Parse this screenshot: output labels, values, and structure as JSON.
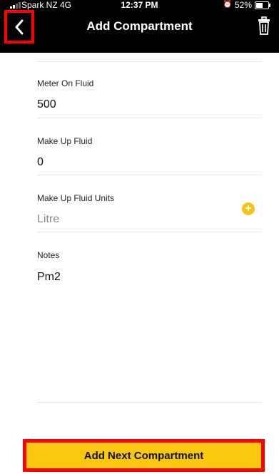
{
  "status_bar": {
    "carrier": "Spark NZ  4G",
    "time": "12:37 PM",
    "battery": "52%",
    "battery_level": 0.52
  },
  "nav": {
    "title": "Add Compartment"
  },
  "fields": {
    "meter_on_fluid": {
      "label": "Meter On Fluid",
      "value": "500"
    },
    "make_up_fluid": {
      "label": "Make Up Fluid",
      "value": "0"
    },
    "make_up_fluid_units": {
      "label": "Make Up Fluid Units",
      "placeholder": "Litre"
    },
    "notes": {
      "label": "Notes",
      "value": "Pm2"
    }
  },
  "footer": {
    "button_label": "Add Next Compartment"
  },
  "colors": {
    "accent_yellow": "#f9c80e",
    "highlight_red": "#ff0000",
    "nav_bg": "#000000"
  },
  "icons": {
    "back": "chevron-left-icon",
    "delete": "trash-icon",
    "add": "plus-circle-icon",
    "alarm": "alarm-icon"
  }
}
